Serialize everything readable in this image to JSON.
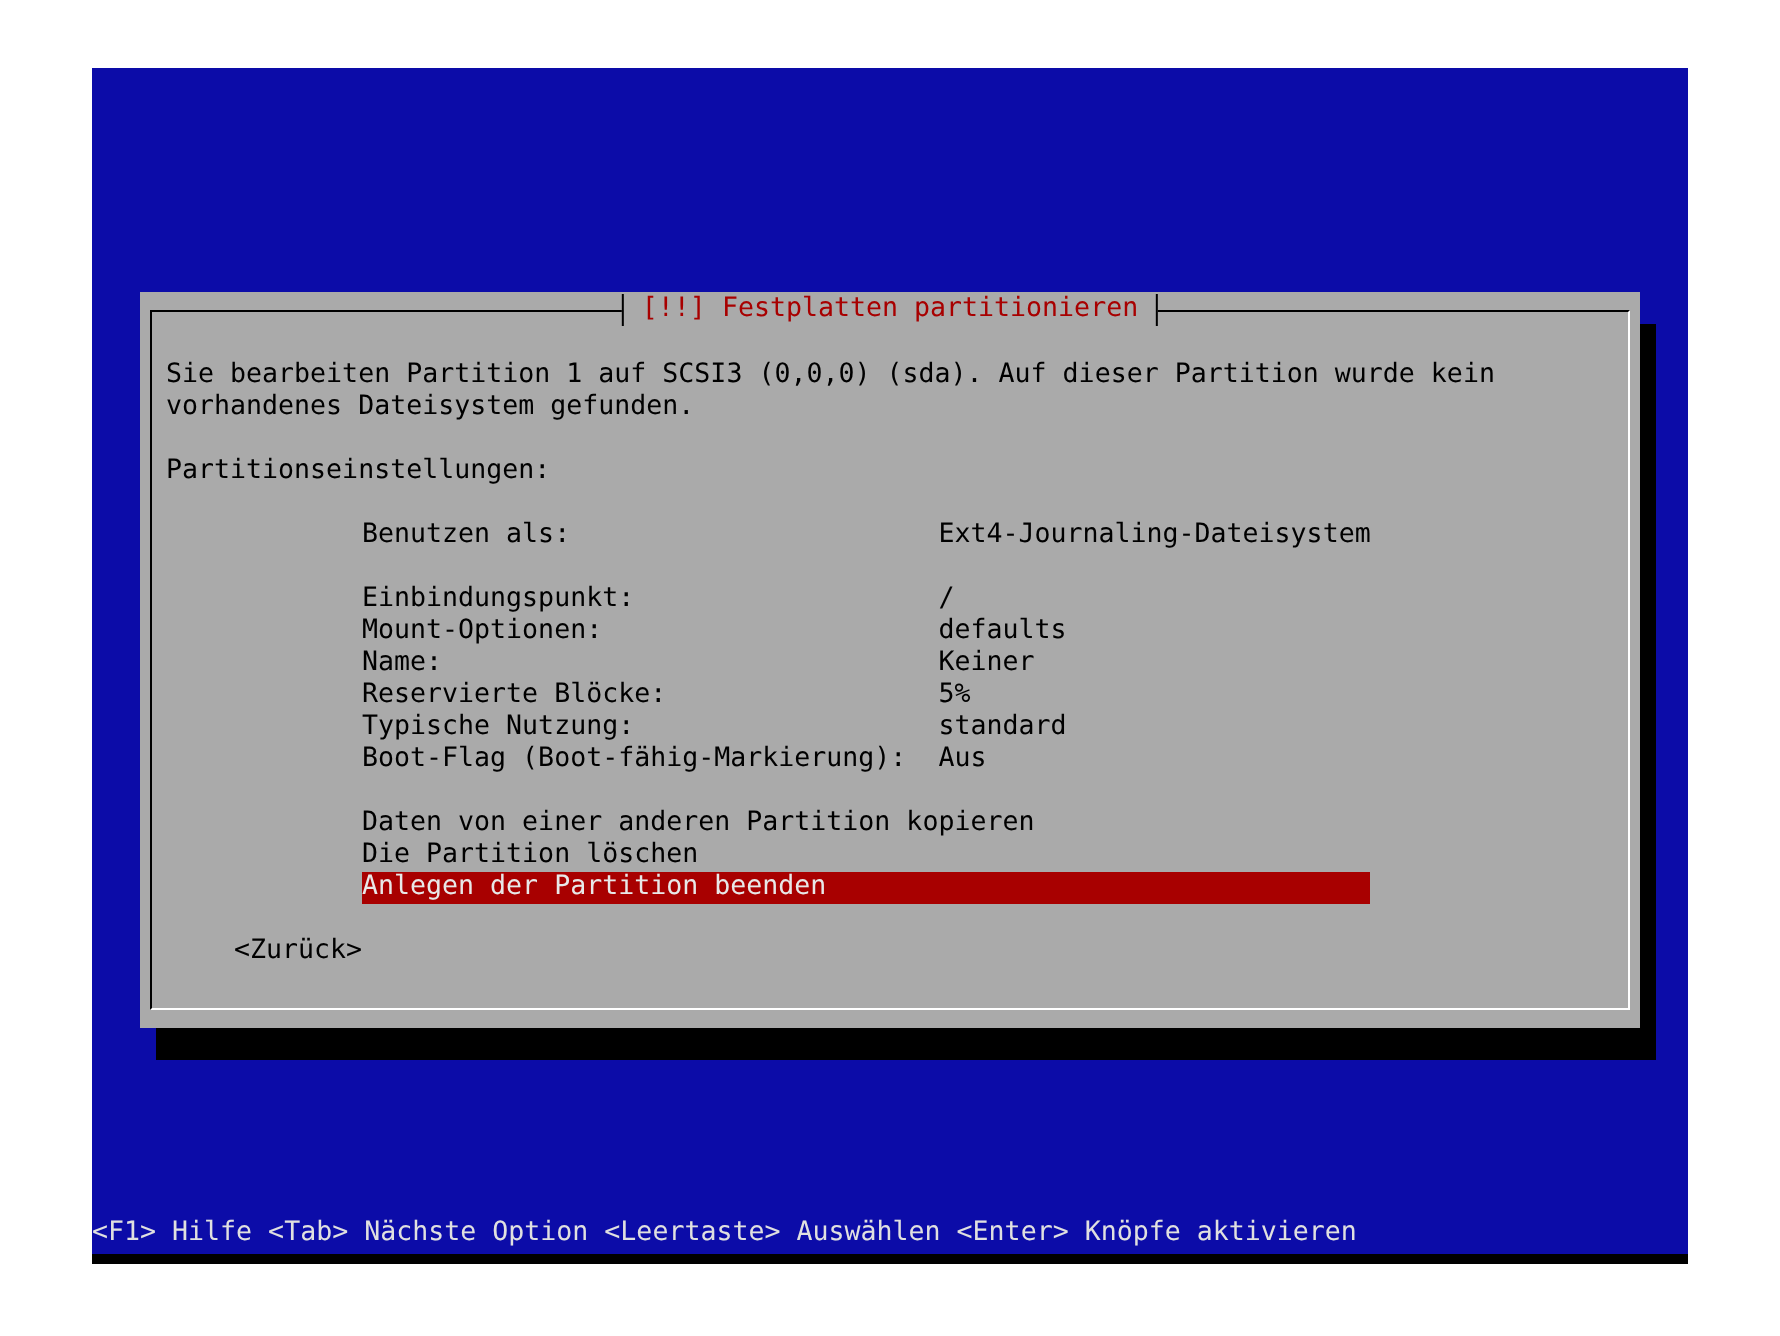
{
  "dialog": {
    "title": "[!!] Festplatten partitionieren",
    "description": "Sie bearbeiten Partition 1 auf SCSI3 (0,0,0) (sda). Auf dieser Partition wurde kein vorhandenes Dateisystem gefunden.",
    "section_label": "Partitionseinstellungen:",
    "menu_groups": [
      {
        "items": [
          {
            "label": "Benutzen als:",
            "value": "Ext4-Journaling-Dateisystem",
            "selected": false
          }
        ]
      },
      {
        "items": [
          {
            "label": "Einbindungspunkt:",
            "value": "/",
            "selected": false
          },
          {
            "label": "Mount-Optionen:",
            "value": "defaults",
            "selected": false
          },
          {
            "label": "Name:",
            "value": "Keiner",
            "selected": false
          },
          {
            "label": "Reservierte Blöcke:",
            "value": "5%",
            "selected": false
          },
          {
            "label": "Typische Nutzung:",
            "value": "standard",
            "selected": false
          },
          {
            "label": "Boot-Flag (Boot-fähig-Markierung):",
            "value": "Aus",
            "selected": false
          }
        ]
      },
      {
        "items": [
          {
            "label": "Daten von einer anderen Partition kopieren",
            "selected": false
          },
          {
            "label": "Die Partition löschen",
            "selected": false
          },
          {
            "label": "Anlegen der Partition beenden",
            "selected": true
          }
        ]
      }
    ],
    "back_button": "<Zurück>"
  },
  "help_bar": "<F1> Hilfe <Tab> Nächste Option <Leertaste> Auswählen <Enter> Knöpfe aktivieren"
}
